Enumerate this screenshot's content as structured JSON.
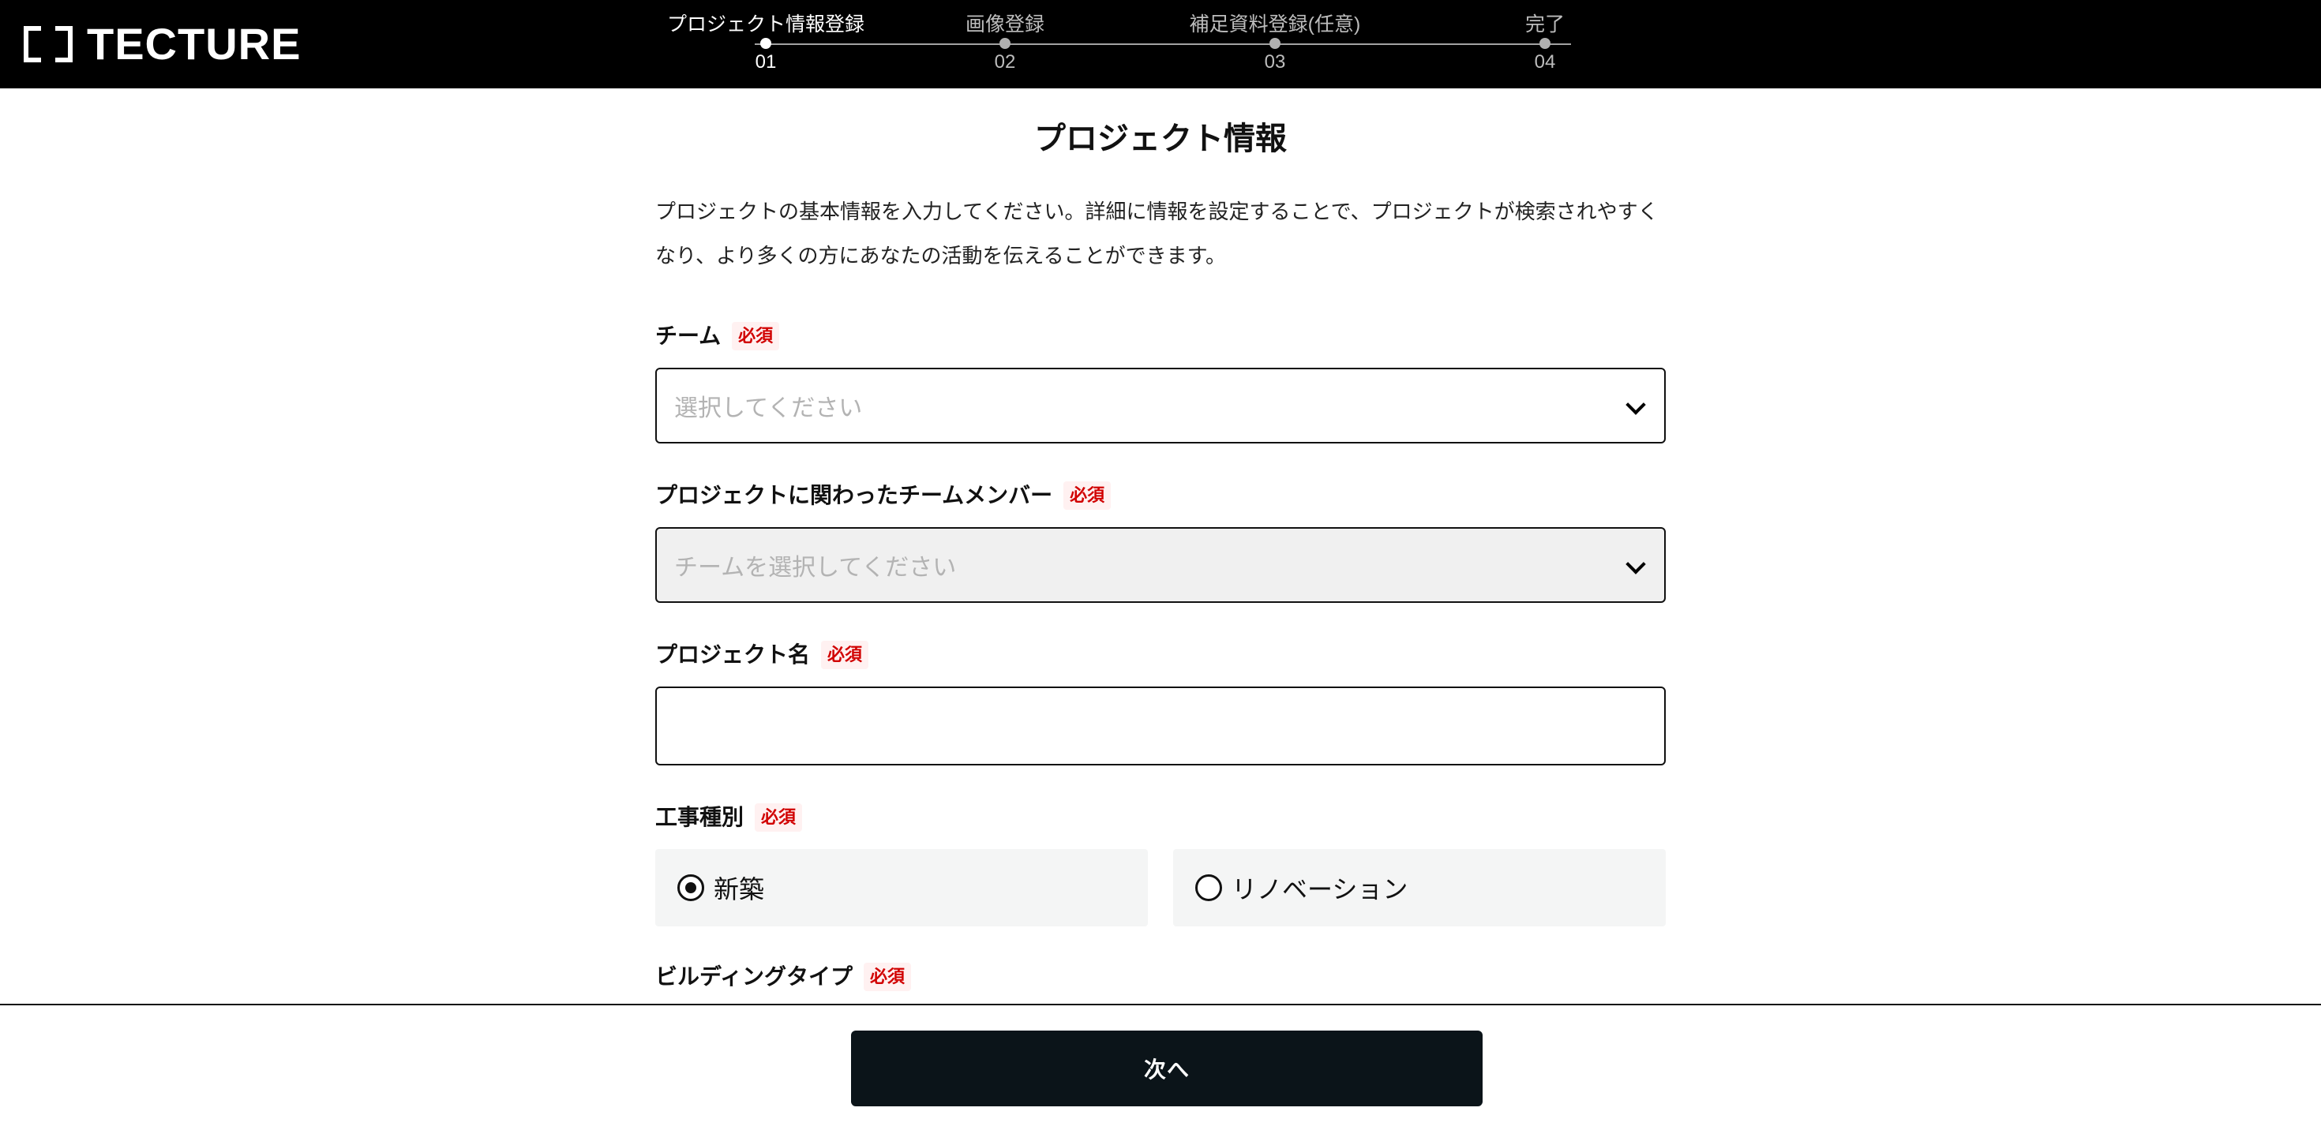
{
  "header": {
    "brand": "TECTURE",
    "steps": [
      {
        "label": "プロジェクト情報登録",
        "num": "01"
      },
      {
        "label": "画像登録",
        "num": "02"
      },
      {
        "label": "補足資料登録(任意)",
        "num": "03"
      },
      {
        "label": "完了",
        "num": "04"
      }
    ]
  },
  "main": {
    "title": "プロジェクト情報",
    "intro": "プロジェクトの基本情報を入力してください。詳細に情報を設定することで、プロジェクトが検索されやすくなり、より多くの方にあなたの活動を伝えることができます。",
    "required_badge": "必須",
    "fields": {
      "team": {
        "label": "チーム",
        "placeholder": "選択してください"
      },
      "members": {
        "label": "プロジェクトに関わったチームメンバー",
        "placeholder": "チームを選択してください"
      },
      "project_name": {
        "label": "プロジェクト名",
        "value": ""
      },
      "construction_type": {
        "label": "工事種別",
        "options": [
          {
            "label": "新築",
            "checked": true
          },
          {
            "label": "リノベーション",
            "checked": false
          }
        ]
      },
      "building_type": {
        "label": "ビルディングタイプ"
      }
    }
  },
  "footer": {
    "next_label": "次へ"
  },
  "colors": {
    "header_bg": "#000000",
    "required": "#d10000",
    "primary_button": "#0b1419"
  }
}
